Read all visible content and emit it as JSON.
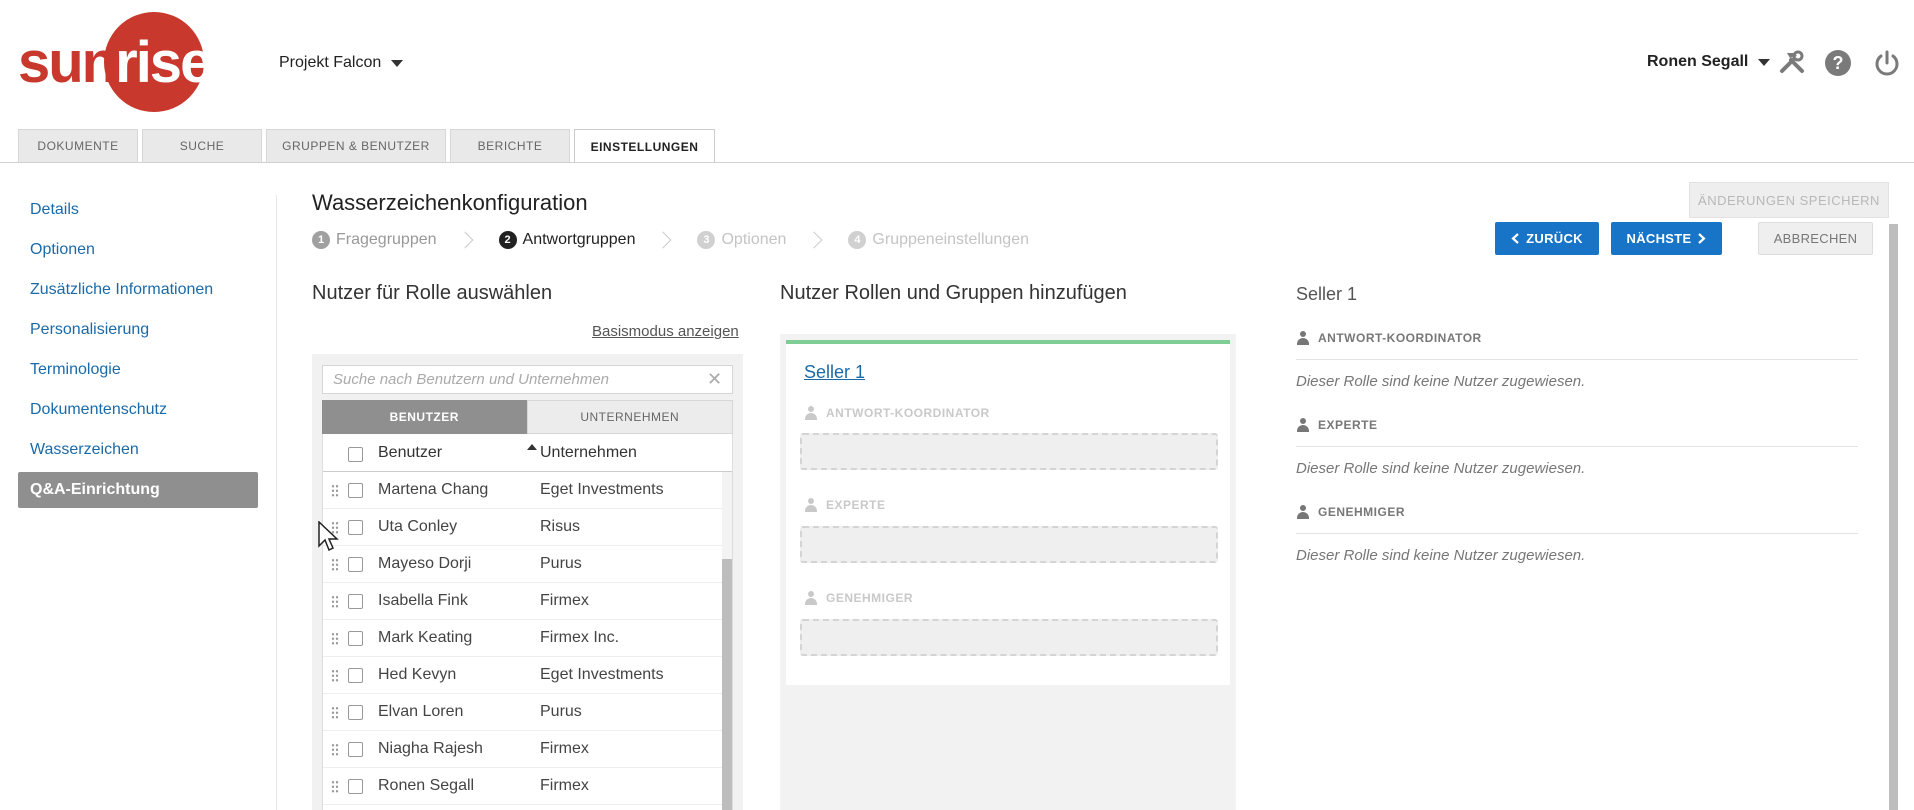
{
  "brand": {
    "logo_part1": "sun",
    "logo_part2": "rise",
    "logo_color": "#c8382c"
  },
  "header": {
    "project": "Projekt Falcon",
    "user": "Ronen Segall",
    "icons": [
      "tools-icon",
      "help-icon",
      "power-icon"
    ]
  },
  "tabs": [
    {
      "label": "DOKUMENTE"
    },
    {
      "label": "SUCHE"
    },
    {
      "label": "GRUPPEN & BENUTZER"
    },
    {
      "label": "BERICHTE"
    },
    {
      "label": "EINSTELLUNGEN",
      "active": true
    }
  ],
  "sidebar": {
    "items": [
      {
        "label": "Details"
      },
      {
        "label": "Optionen"
      },
      {
        "label": "Zusätzliche Informationen"
      },
      {
        "label": "Personalisierung"
      },
      {
        "label": "Terminologie"
      },
      {
        "label": "Dokumentenschutz"
      },
      {
        "label": "Wasserzeichen"
      },
      {
        "label": "Q&A-Einrichtung",
        "active": true
      }
    ]
  },
  "main": {
    "title": "Wasserzeichenkonfiguration",
    "save_label": "ÄNDERUNGEN SPEICHERN",
    "steps": [
      {
        "num": "1",
        "label": "Fragegruppen"
      },
      {
        "num": "2",
        "label": "Antwortgruppen"
      },
      {
        "num": "3",
        "label": "Optionen"
      },
      {
        "num": "4",
        "label": "Gruppeneinstellungen"
      }
    ],
    "back_label": "ZURÜCK",
    "next_label": "NÄCHSTE",
    "cancel_label": "ABBRECHEN"
  },
  "left": {
    "heading": "Nutzer für Rolle auswählen",
    "basic_mode_link": "Basismodus anzeigen",
    "search_placeholder": "Suche nach Benutzern und Unternehmen",
    "seg_users": "BENUTZER",
    "seg_companies": "UNTERNEHMEN",
    "col_user": "Benutzer",
    "col_company": "Unternehmen",
    "rows": [
      {
        "name": "Martena Chang",
        "company": "Eget Investments"
      },
      {
        "name": "Uta Conley",
        "company": "Risus"
      },
      {
        "name": "Mayeso Dorji",
        "company": "Purus"
      },
      {
        "name": "Isabella Fink",
        "company": "Firmex"
      },
      {
        "name": "Mark Keating",
        "company": "Firmex Inc."
      },
      {
        "name": "Hed Kevyn",
        "company": "Eget Investments"
      },
      {
        "name": "Elvan Loren",
        "company": "Purus"
      },
      {
        "name": "Niagha Rajesh",
        "company": "Firmex"
      },
      {
        "name": "Ronen Segall",
        "company": "Firmex"
      }
    ]
  },
  "middle": {
    "heading": "Nutzer Rollen und Gruppen hinzufügen",
    "group_name": "Seller 1",
    "roles": [
      "ANTWORT-KOORDINATOR",
      "EXPERTE",
      "GENEHMIGER"
    ]
  },
  "right": {
    "title": "Seller 1",
    "roles": [
      {
        "label": "ANTWORT-KOORDINATOR",
        "empty": "Dieser Rolle sind keine Nutzer zugewiesen."
      },
      {
        "label": "EXPERTE",
        "empty": "Dieser Rolle sind keine Nutzer zugewiesen."
      },
      {
        "label": "GENEHMIGER",
        "empty": "Dieser Rolle sind keine Nutzer zugewiesen."
      }
    ]
  }
}
